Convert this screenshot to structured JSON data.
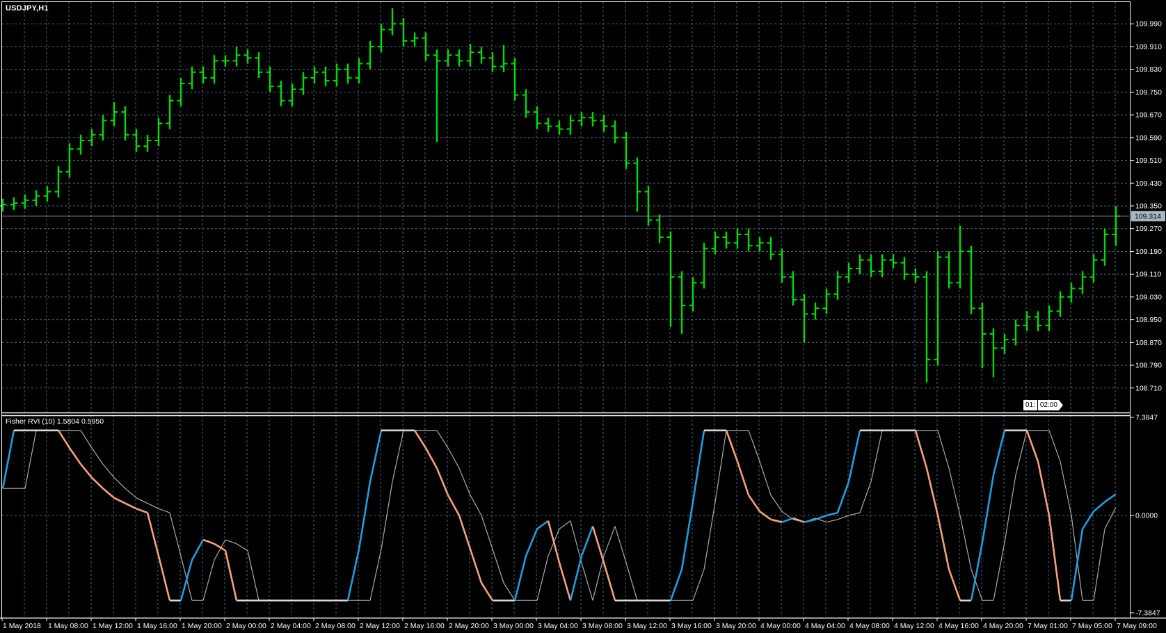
{
  "window": {
    "symbol_period": "USDJPY,H1"
  },
  "price_line": {
    "value": "109.314"
  },
  "tooltip": {
    "left": "01:",
    "right": "02:00"
  },
  "indicator": {
    "title": "Fisher RVI (10) 1.5804 0.5950",
    "name": "Fisher RVI",
    "period": 10,
    "last_main": 1.5804,
    "last_signal": 0.595,
    "scale_labels": [
      "7.3847",
      "0.0000",
      "-7.3847"
    ],
    "scale_values": [
      7.3847,
      0.0,
      -7.3847
    ]
  },
  "price_axis": {
    "labels": [
      "109.990",
      "109.910",
      "109.830",
      "109.750",
      "109.670",
      "109.590",
      "109.510",
      "109.430",
      "109.350",
      "109.270",
      "109.190",
      "109.110",
      "109.030",
      "108.950",
      "108.870",
      "108.790",
      "108.710"
    ]
  },
  "time_axis": {
    "labels": [
      "1 May 2018",
      "1 May 08:00",
      "1 May 12:00",
      "1 May 16:00",
      "1 May 20:00",
      "2 May 00:00",
      "2 May 04:00",
      "2 May 08:00",
      "2 May 12:00",
      "2 May 16:00",
      "2 May 20:00",
      "3 May 00:00",
      "3 May 04:00",
      "3 May 08:00",
      "3 May 12:00",
      "3 May 16:00",
      "3 May 20:00",
      "4 May 00:00",
      "4 May 04:00",
      "4 May 08:00",
      "4 May 12:00",
      "4 May 16:00",
      "4 May 20:00",
      "7 May 01:00",
      "7 May 05:00",
      "7 May 09:00"
    ]
  },
  "colors": {
    "background": "#000000",
    "frame": "#ffffff",
    "grid": "#4e6374",
    "bars_green": "#00db00",
    "text": "#ffffff",
    "fisher_up": "#1f9fe0",
    "fisher_down": "#f7a17c",
    "fisher_flat": "#d9d9d9",
    "signal_gray": "#ababab",
    "price_line": "#8a9aa5",
    "price_tag_bg": "#a9b6c2",
    "price_tag_text": "#000000",
    "tooltip_bg": "#ffffff"
  },
  "chart_data": [
    {
      "type": "bar",
      "subtype": "ohlc-bars",
      "symbol": "USDJPY",
      "timeframe": "H1",
      "ylim": [
        108.66,
        110.1
      ],
      "grid": true,
      "open_first": 109.35,
      "closes": [
        109.355,
        109.36,
        109.37,
        109.385,
        109.4,
        109.47,
        109.55,
        109.58,
        109.6,
        109.65,
        109.68,
        109.6,
        109.56,
        109.58,
        109.64,
        109.72,
        109.78,
        109.82,
        109.8,
        109.86,
        109.86,
        109.88,
        109.87,
        109.82,
        109.77,
        109.72,
        109.76,
        109.8,
        109.82,
        109.79,
        109.83,
        109.8,
        109.85,
        109.91,
        109.97,
        109.99,
        109.93,
        109.94,
        109.88,
        109.86,
        109.88,
        109.86,
        109.89,
        109.87,
        109.84,
        109.85,
        109.74,
        109.68,
        109.64,
        109.63,
        109.62,
        109.65,
        109.66,
        109.65,
        109.63,
        109.59,
        109.5,
        109.4,
        109.3,
        109.24,
        109.1,
        109.0,
        109.08,
        109.2,
        109.24,
        109.22,
        109.25,
        109.21,
        109.22,
        109.18,
        109.1,
        109.02,
        108.97,
        108.99,
        109.04,
        109.1,
        109.13,
        109.16,
        109.12,
        109.16,
        109.15,
        109.11,
        109.1,
        108.81,
        109.17,
        109.08,
        109.19,
        108.99,
        108.9,
        108.85,
        108.88,
        108.93,
        108.96,
        108.93,
        108.98,
        109.03,
        109.06,
        109.1,
        109.16,
        109.25,
        109.314
      ],
      "default_wick": 0.02,
      "wick_overrides": {
        "10": {
          "h": 109.715
        },
        "21": {
          "h": 109.91
        },
        "35": {
          "h": 110.045
        },
        "39": {
          "l": 109.575
        },
        "42": {
          "h": 109.92
        },
        "45": {
          "h": 109.915
        },
        "57": {
          "l": 109.33
        },
        "60": {
          "l": 108.925
        },
        "61": {
          "l": 108.9
        },
        "72": {
          "l": 108.87
        },
        "83": {
          "l": 108.73
        },
        "86": {
          "h": 109.28
        },
        "88": {
          "l": 108.78
        },
        "89": {
          "l": 108.748
        },
        "100": {
          "h": 109.35,
          "l": 109.21
        }
      }
    },
    {
      "type": "line",
      "title": "Fisher RVI (10)",
      "ylim": [
        -7.3847,
        7.3847
      ],
      "legend_position": "top-left",
      "series": [
        {
          "name": "fisher-main",
          "values": [
            2.0,
            6.3,
            6.3,
            6.3,
            6.3,
            6.3,
            5.0,
            3.8,
            2.8,
            2.0,
            1.3,
            0.9,
            0.5,
            0.2,
            -3.0,
            -6.3,
            -6.3,
            -3.3,
            -1.8,
            -2.1,
            -2.6,
            -6.3,
            -6.3,
            -6.3,
            -6.3,
            -6.3,
            -6.3,
            -6.3,
            -6.3,
            -6.3,
            -6.3,
            -6.3,
            -2.5,
            2.5,
            6.3,
            6.3,
            6.3,
            6.3,
            5.0,
            3.5,
            1.5,
            0.0,
            -2.5,
            -5.0,
            -6.3,
            -6.3,
            -6.3,
            -3.0,
            -1.0,
            -0.4,
            -3.5,
            -6.3,
            -3.0,
            -0.8,
            -3.5,
            -6.3,
            -6.3,
            -6.3,
            -6.3,
            -6.3,
            -6.3,
            -4.0,
            1.0,
            6.3,
            6.3,
            6.3,
            4.0,
            1.5,
            0.3,
            -0.3,
            -0.5,
            -0.2,
            -0.5,
            -0.3,
            0.0,
            0.2,
            2.5,
            6.3,
            6.3,
            6.3,
            6.3,
            6.3,
            6.3,
            3.5,
            0.0,
            -4.0,
            -6.3,
            -6.3,
            -2.0,
            3.0,
            6.3,
            6.3,
            6.3,
            4.0,
            0.0,
            -6.3,
            -6.3,
            -1.0,
            0.3,
            1.0,
            1.5804
          ]
        },
        {
          "name": "fisher-signal",
          "values": [
            2.0,
            2.0,
            2.0,
            6.3,
            6.3,
            6.3,
            6.3,
            6.3,
            5.0,
            3.8,
            2.8,
            2.0,
            1.3,
            0.9,
            0.5,
            0.2,
            -3.0,
            -6.3,
            -6.3,
            -3.3,
            -1.8,
            -2.1,
            -2.6,
            -6.3,
            -6.3,
            -6.3,
            -6.3,
            -6.3,
            -6.3,
            -6.3,
            -6.3,
            -6.3,
            -6.3,
            -6.3,
            -2.5,
            2.5,
            6.3,
            6.3,
            6.3,
            6.3,
            5.0,
            3.5,
            1.5,
            0.0,
            -2.5,
            -5.0,
            -6.3,
            -6.3,
            -6.3,
            -3.0,
            -1.0,
            -0.4,
            -3.5,
            -6.3,
            -3.0,
            -0.8,
            -3.5,
            -6.3,
            -6.3,
            -6.3,
            -6.3,
            -6.3,
            -6.3,
            -4.0,
            1.0,
            6.3,
            6.3,
            6.3,
            4.0,
            1.5,
            0.3,
            -0.3,
            -0.5,
            -0.2,
            -0.5,
            -0.3,
            0.0,
            0.2,
            2.5,
            6.3,
            6.3,
            6.3,
            6.3,
            6.3,
            6.3,
            3.5,
            0.0,
            -4.0,
            -6.3,
            -6.3,
            -2.0,
            3.0,
            6.3,
            6.3,
            6.3,
            4.0,
            0.0,
            -6.3,
            -6.3,
            -1.0,
            0.595
          ]
        }
      ]
    }
  ]
}
